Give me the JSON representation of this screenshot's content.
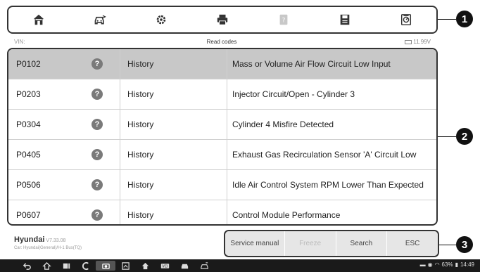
{
  "toolbar": {
    "buttons": [
      {
        "icon": "home-icon"
      },
      {
        "icon": "vehicle-swap-icon"
      },
      {
        "icon": "settings-icon"
      },
      {
        "icon": "print-icon"
      },
      {
        "icon": "help-icon"
      },
      {
        "icon": "save-icon"
      },
      {
        "icon": "data-logging-icon"
      }
    ]
  },
  "status_bar": {
    "vin_label": "VIN:",
    "title": "Read codes",
    "battery_voltage": "11.99V"
  },
  "dtc_table": {
    "rows": [
      {
        "code": "P0102",
        "status": "History",
        "description": "Mass or Volume Air Flow Circuit Low Input"
      },
      {
        "code": "P0203",
        "status": "History",
        "description": "Injector Circuit/Open - Cylinder 3"
      },
      {
        "code": "P0304",
        "status": "History",
        "description": "Cylinder 4 Misfire Detected"
      },
      {
        "code": "P0405",
        "status": "History",
        "description": "Exhaust Gas Recirculation Sensor 'A' Circuit Low"
      },
      {
        "code": "P0506",
        "status": "History",
        "description": "Idle Air Control System RPM Lower Than Expected"
      },
      {
        "code": "P0607",
        "status": "History",
        "description": "Control Module Performance"
      }
    ],
    "help_glyph": "?"
  },
  "vehicle_info": {
    "make": "Hyundai",
    "version": "V7.33.08",
    "path": "Car: Hyundai(General)/H-1 Bus(TQ)"
  },
  "actions": [
    {
      "label": "Service manual",
      "enabled": true
    },
    {
      "label": "Freeze",
      "enabled": false
    },
    {
      "label": "Search",
      "enabled": true
    },
    {
      "label": "ESC",
      "enabled": true
    }
  ],
  "callouts": [
    "1",
    "2",
    "3"
  ],
  "system_tray": {
    "battery": "63%",
    "time": "14:49"
  }
}
